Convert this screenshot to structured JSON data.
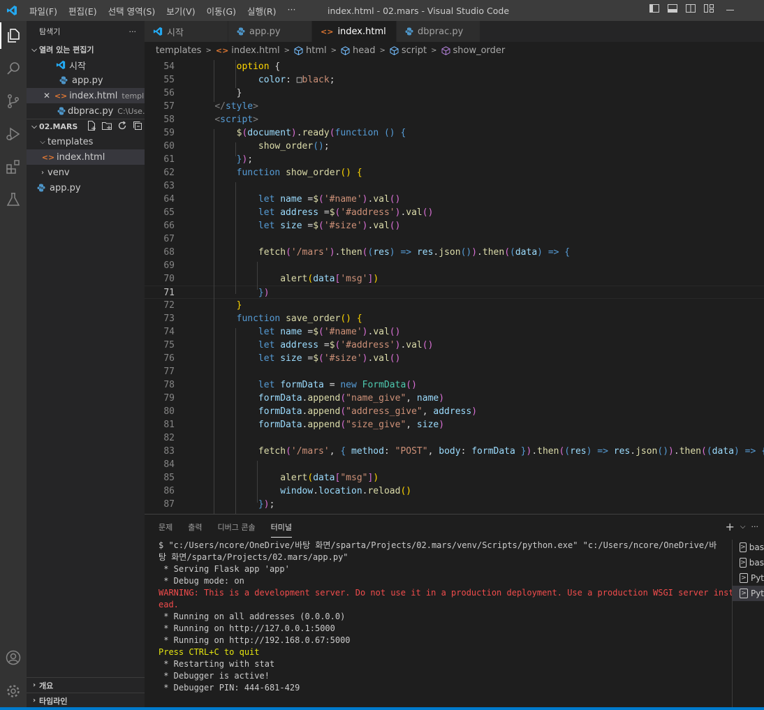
{
  "window": {
    "title": "index.html - 02.mars - Visual Studio Code",
    "menu": [
      "파일(F)",
      "편집(E)",
      "선택 영역(S)",
      "보기(V)",
      "이동(G)",
      "실행(R)",
      "···"
    ]
  },
  "activity_bar": {
    "icons": [
      "explorer-icon",
      "search-icon",
      "source-control-icon",
      "run-debug-icon",
      "extensions-icon",
      "testing-icon",
      "account-icon",
      "settings-gear-icon"
    ]
  },
  "sidebar": {
    "title": "탐색기",
    "more": "···",
    "open_editors": {
      "label": "열려 있는 편집기",
      "items": [
        {
          "label": "시작",
          "desc": "",
          "icon": "vscode-icon"
        },
        {
          "label": "app.py",
          "desc": "",
          "icon": "python-icon"
        },
        {
          "label": "index.html",
          "desc": "templ...",
          "icon": "html-icon",
          "close": "✕"
        },
        {
          "label": "dbprac.py",
          "desc": "C:\\Use...",
          "icon": "python-icon"
        }
      ]
    },
    "workspace": {
      "label": "02.MARS",
      "items": [
        {
          "label": "templates"
        },
        {
          "label": "index.html"
        },
        {
          "label": "venv"
        },
        {
          "label": "app.py"
        }
      ]
    },
    "outline_label": "개요",
    "timeline_label": "타임라인"
  },
  "tabs": [
    {
      "label": "시작",
      "icon": "vscode-icon"
    },
    {
      "label": "app.py",
      "icon": "python-icon"
    },
    {
      "label": "index.html",
      "icon": "html-icon",
      "active": true
    },
    {
      "label": "dbprac.py",
      "icon": "python-icon"
    }
  ],
  "breadcrumb": [
    "templates",
    "index.html",
    "html",
    "head",
    "script",
    "show_order"
  ],
  "editor": {
    "lines": [
      {
        "n": "54",
        "html": "<span class='y'>        option</span> <span class='w'>{</span>"
      },
      {
        "n": "55",
        "html": "            <span class='v'>color</span><span class='w'>: </span><span class='w'>□</span><span class='s'>black</span><span class='w'>;</span>"
      },
      {
        "n": "56",
        "html": "        <span class='w'>}</span>"
      },
      {
        "n": "57",
        "html": "    <span class='t'>&lt;/</span><span class='k'>style</span><span class='t'>&gt;</span>"
      },
      {
        "n": "58",
        "html": "    <span class='t'>&lt;</span><span class='k'>script</span><span class='t'>&gt;</span>"
      },
      {
        "n": "59",
        "html": "        <span class='f'>$</span><span class='p'>(</span><span class='v'>document</span><span class='p'>)</span><span class='w'>.</span><span class='f'>ready</span><span class='p'>(</span><span class='k'>function</span> <span class='k'>()</span> <span class='k'>{</span>"
      },
      {
        "n": "60",
        "html": "            <span class='f'>show_order</span><span class='k'>()</span><span class='w'>;</span>"
      },
      {
        "n": "61",
        "html": "        <span class='k'>}</span><span class='p'>)</span><span class='w'>;</span>"
      },
      {
        "n": "62",
        "html": "        <span class='k'>function</span> <span class='f'>show_order</span><span class='y'>()</span> <span class='y'>{</span>"
      },
      {
        "n": "63",
        "html": ""
      },
      {
        "n": "64",
        "html": "            <span class='k'>let</span> <span class='v'>name</span> <span class='w'>=</span><span class='f'>$</span><span class='p'>(</span><span class='s'>'#name'</span><span class='p'>)</span><span class='w'>.</span><span class='f'>val</span><span class='p'>()</span>"
      },
      {
        "n": "65",
        "html": "            <span class='k'>let</span> <span class='v'>address</span> <span class='w'>=</span><span class='f'>$</span><span class='p'>(</span><span class='s'>'#address'</span><span class='p'>)</span><span class='w'>.</span><span class='f'>val</span><span class='p'>()</span>"
      },
      {
        "n": "66",
        "html": "            <span class='k'>let</span> <span class='v'>size</span> <span class='w'>=</span><span class='f'>$</span><span class='p'>(</span><span class='s'>'#size'</span><span class='p'>)</span><span class='w'>.</span><span class='f'>val</span><span class='p'>()</span>"
      },
      {
        "n": "67",
        "html": ""
      },
      {
        "n": "68",
        "html": "            <span class='f'>fetch</span><span class='p'>(</span><span class='s'>'/mars'</span><span class='p'>)</span><span class='w'>.</span><span class='f'>then</span><span class='p'>(</span><span class='k'>(</span><span class='v'>res</span><span class='k'>)</span> <span class='k'>=&gt;</span> <span class='v'>res</span><span class='w'>.</span><span class='f'>json</span><span class='k'>()</span><span class='p'>)</span><span class='w'>.</span><span class='f'>then</span><span class='p'>(</span><span class='k'>(</span><span class='v'>data</span><span class='k'>)</span> <span class='k'>=&gt;</span> <span class='k'>{</span>"
      },
      {
        "n": "69",
        "html": ""
      },
      {
        "n": "70",
        "html": "                <span class='f'>alert</span><span class='y'>(</span><span class='v'>data</span><span class='p'>[</span><span class='s'>'msg'</span><span class='p'>]</span><span class='y'>)</span>"
      },
      {
        "n": "71",
        "html": "            <span class='k'>}</span><span class='p'>)</span>",
        "current": true
      },
      {
        "n": "72",
        "html": "        <span class='y'>}</span>"
      },
      {
        "n": "73",
        "html": "        <span class='k'>function</span> <span class='f'>save_order</span><span class='y'>()</span> <span class='y'>{</span>"
      },
      {
        "n": "74",
        "html": "            <span class='k'>let</span> <span class='v'>name</span> <span class='w'>=</span><span class='f'>$</span><span class='p'>(</span><span class='s'>'#name'</span><span class='p'>)</span><span class='w'>.</span><span class='f'>val</span><span class='p'>()</span>"
      },
      {
        "n": "75",
        "html": "            <span class='k'>let</span> <span class='v'>address</span> <span class='w'>=</span><span class='f'>$</span><span class='p'>(</span><span class='s'>'#address'</span><span class='p'>)</span><span class='w'>.</span><span class='f'>val</span><span class='p'>()</span>"
      },
      {
        "n": "76",
        "html": "            <span class='k'>let</span> <span class='v'>size</span> <span class='w'>=</span><span class='f'>$</span><span class='p'>(</span><span class='s'>'#size'</span><span class='p'>)</span><span class='w'>.</span><span class='f'>val</span><span class='p'>()</span>"
      },
      {
        "n": "77",
        "html": ""
      },
      {
        "n": "78",
        "html": "            <span class='k'>let</span> <span class='v'>formData</span> <span class='w'>=</span> <span class='k'>new</span> <span class='c'>FormData</span><span class='p'>()</span>"
      },
      {
        "n": "79",
        "html": "            <span class='v'>formData</span><span class='w'>.</span><span class='f'>append</span><span class='p'>(</span><span class='s'>\"name_give\"</span><span class='w'>, </span><span class='v'>name</span><span class='p'>)</span>"
      },
      {
        "n": "80",
        "html": "            <span class='v'>formData</span><span class='w'>.</span><span class='f'>append</span><span class='p'>(</span><span class='s'>\"address_give\"</span><span class='w'>, </span><span class='v'>address</span><span class='p'>)</span>"
      },
      {
        "n": "81",
        "html": "            <span class='v'>formData</span><span class='w'>.</span><span class='f'>append</span><span class='p'>(</span><span class='s'>\"size_give\"</span><span class='w'>, </span><span class='v'>size</span><span class='p'>)</span>"
      },
      {
        "n": "82",
        "html": ""
      },
      {
        "n": "83",
        "html": "            <span class='f'>fetch</span><span class='p'>(</span><span class='s'>'/mars'</span><span class='w'>, </span><span class='k'>{</span> <span class='v'>method</span><span class='w'>: </span><span class='s'>\"POST\"</span><span class='w'>, </span><span class='v'>body</span><span class='w'>: </span><span class='v'>formData</span> <span class='k'>}</span><span class='p'>)</span><span class='w'>.</span><span class='f'>then</span><span class='p'>(</span><span class='k'>(</span><span class='v'>res</span><span class='k'>)</span> <span class='k'>=&gt;</span> <span class='v'>res</span><span class='w'>.</span><span class='f'>json</span><span class='k'>()</span><span class='p'>)</span><span class='w'>.</span><span class='f'>then</span><span class='p'>(</span><span class='k'>(</span><span class='v'>data</span><span class='k'>)</span> <span class='k'>=&gt;</span> <span class='k'>{</span>"
      },
      {
        "n": "84",
        "html": ""
      },
      {
        "n": "85",
        "html": "                <span class='f'>alert</span><span class='y'>(</span><span class='v'>data</span><span class='p'>[</span><span class='s'>\"msg\"</span><span class='p'>]</span><span class='y'>)</span>"
      },
      {
        "n": "86",
        "html": "                <span class='v'>window</span><span class='w'>.</span><span class='v'>location</span><span class='w'>.</span><span class='f'>reload</span><span class='y'>()</span>"
      },
      {
        "n": "87",
        "html": "            <span class='k'>}</span><span class='p'>)</span><span class='w'>;</span>"
      }
    ]
  },
  "panel": {
    "tabs": [
      "문제",
      "출력",
      "디버그 콘솔",
      "터미널"
    ],
    "active_tab": "터미널",
    "add_label": "+",
    "terminal_lines": [
      {
        "text": "$ \"c:/Users/ncore/OneDrive/바탕 화면/sparta/Projects/02.mars/venv/Scripts/python.exe\" \"c:/Users/ncore/OneDrive/바",
        "style": ""
      },
      {
        "text": "탕 화면/sparta/Projects/02.mars/app.py\"",
        "style": ""
      },
      {
        "text": " * Serving Flask app 'app'",
        "style": ""
      },
      {
        "text": " * Debug mode: on",
        "style": ""
      },
      {
        "text": "WARNING: This is a development server. Do not use it in a production deployment. Use a production WSGI server inst",
        "style": "red"
      },
      {
        "text": "ead.",
        "style": "red"
      },
      {
        "text": " * Running on all addresses (0.0.0.0)",
        "style": ""
      },
      {
        "text": " * Running on http://127.0.0.1:5000",
        "style": ""
      },
      {
        "text": " * Running on http://192.168.0.67:5000",
        "style": ""
      },
      {
        "text": "Press CTRL+C to quit",
        "style": "yel"
      },
      {
        "text": " * Restarting with stat",
        "style": ""
      },
      {
        "text": " * Debugger is active!",
        "style": ""
      },
      {
        "text": " * Debugger PIN: 444-681-429",
        "style": ""
      }
    ],
    "terminal_list": [
      "bas",
      "bas",
      "Pyt",
      "Pyt"
    ]
  },
  "colors": {
    "accent": "#007acc",
    "title_bar": "#3c3c3c",
    "editor_bg": "#1e1e1e",
    "sidebar_bg": "#252526"
  }
}
